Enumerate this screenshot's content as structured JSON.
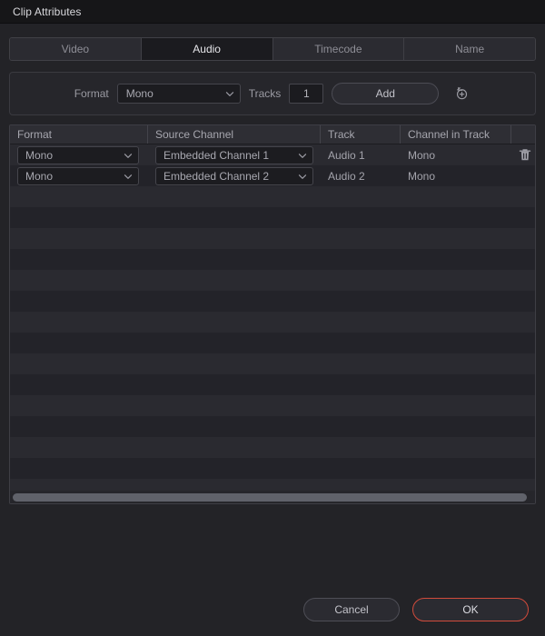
{
  "window": {
    "title": "Clip Attributes"
  },
  "tabs": [
    {
      "label": "Video",
      "active": false,
      "name": "tab-video"
    },
    {
      "label": "Audio",
      "active": true,
      "name": "tab-audio"
    },
    {
      "label": "Timecode",
      "active": false,
      "name": "tab-timecode"
    },
    {
      "label": "Name",
      "active": false,
      "name": "tab-name"
    }
  ],
  "controls": {
    "format_label": "Format",
    "format_value": "Mono",
    "tracks_label": "Tracks",
    "tracks_value": "1",
    "add_label": "Add",
    "reset_icon": "reset-add-icon"
  },
  "table": {
    "columns": [
      {
        "label": "Format"
      },
      {
        "label": "Source Channel"
      },
      {
        "label": "Track"
      },
      {
        "label": "Channel in Track"
      },
      {
        "label": ""
      }
    ],
    "rows": [
      {
        "format": "Mono",
        "source_channel": "Embedded Channel 1",
        "track": "Audio 1",
        "channel_in_track": "Mono",
        "delete_icon": "trash-icon",
        "has_delete": true
      },
      {
        "format": "Mono",
        "source_channel": "Embedded Channel 2",
        "track": "Audio 2",
        "channel_in_track": "Mono",
        "delete_icon": "trash-icon",
        "has_delete": false
      }
    ],
    "empty_row_count": 15,
    "scrollbar": {
      "orientation": "horizontal",
      "thumb_fraction": "0.99"
    }
  },
  "footer": {
    "cancel_label": "Cancel",
    "ok_label": "OK"
  },
  "colors": {
    "window_bg": "#232327",
    "titlebar_bg": "#161618",
    "panel_bg": "#26262b",
    "row_odd": "#2a2a30",
    "row_even": "#232329",
    "accent_ok": "#d14b3c",
    "text_primary": "#d9d9dd",
    "text_secondary": "#8e8e96",
    "scroll_thumb": "#60626a"
  }
}
